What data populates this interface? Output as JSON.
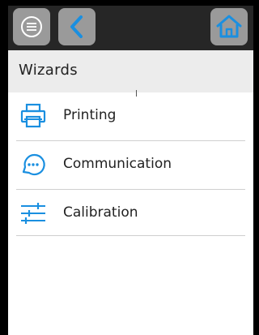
{
  "header": {
    "menu_button": {
      "icon": "menu-circle-icon"
    },
    "back_button": {
      "icon": "chevron-left-icon"
    },
    "home_button": {
      "icon": "home-icon"
    },
    "accent_color": "#1a8fe0"
  },
  "page": {
    "title": "Wizards"
  },
  "wizards": {
    "items": [
      {
        "label": "Printing",
        "icon": "printer-icon"
      },
      {
        "label": "Communication",
        "icon": "chat-dots-icon"
      },
      {
        "label": "Calibration",
        "icon": "sliders-icon"
      }
    ]
  }
}
